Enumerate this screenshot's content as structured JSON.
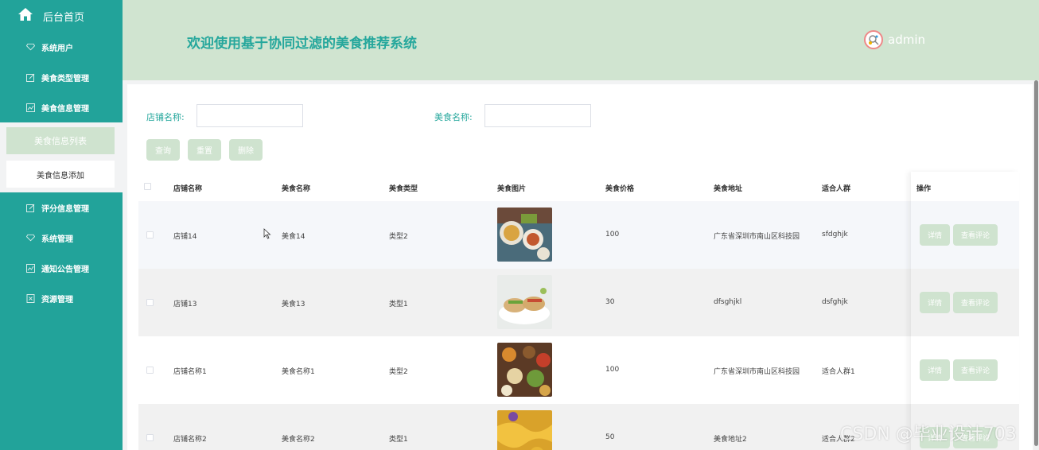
{
  "sidebar": {
    "home": "后台首页",
    "items": [
      {
        "label": "系统用户"
      },
      {
        "label": "美食类型管理"
      },
      {
        "label": "美食信息管理"
      },
      {
        "label": "评分信息管理"
      },
      {
        "label": "系统管理"
      },
      {
        "label": "通知公告管理"
      },
      {
        "label": "资源管理"
      }
    ],
    "submenu": [
      "美食信息列表",
      "美食信息添加"
    ]
  },
  "header": {
    "title": "欢迎使用基于协同过滤的美食推荐系统",
    "user": "admin"
  },
  "search": {
    "shop_label": "店铺名称:",
    "food_label": "美食名称:",
    "shop_value": "",
    "food_value": ""
  },
  "buttons": {
    "query": "查询",
    "reset": "重置",
    "delete": "删除"
  },
  "table": {
    "columns": [
      "店铺名称",
      "美食名称",
      "美食类型",
      "美食图片",
      "美食价格",
      "美食地址",
      "适合人群",
      "操作"
    ],
    "rows": [
      {
        "shop": "店铺14",
        "food": "美食14",
        "type": "类型2",
        "price": "100",
        "address": "广东省深圳市南山区科技园",
        "crowd": "sfdghjk"
      },
      {
        "shop": "店铺13",
        "food": "美食13",
        "type": "类型1",
        "price": "30",
        "address": "dfsghjkl",
        "crowd": "dsfghjk"
      },
      {
        "shop": "店铺名称1",
        "food": "美食名称1",
        "type": "类型2",
        "price": "100",
        "address": "广东省深圳市南山区科技园",
        "crowd": "适合人群1"
      },
      {
        "shop": "店铺名称2",
        "food": "美食名称2",
        "type": "类型1",
        "price": "50",
        "address": "美食地址2",
        "crowd": "适合人群2"
      }
    ],
    "op_detail": "详情",
    "op_comment": "查看评论"
  },
  "watermark": "CSDN @毕业设计703",
  "colors": {
    "sidebar": "#22a39a",
    "header": "#d0e4d0",
    "accent": "#25a79c",
    "button": "#cfe3cf"
  }
}
